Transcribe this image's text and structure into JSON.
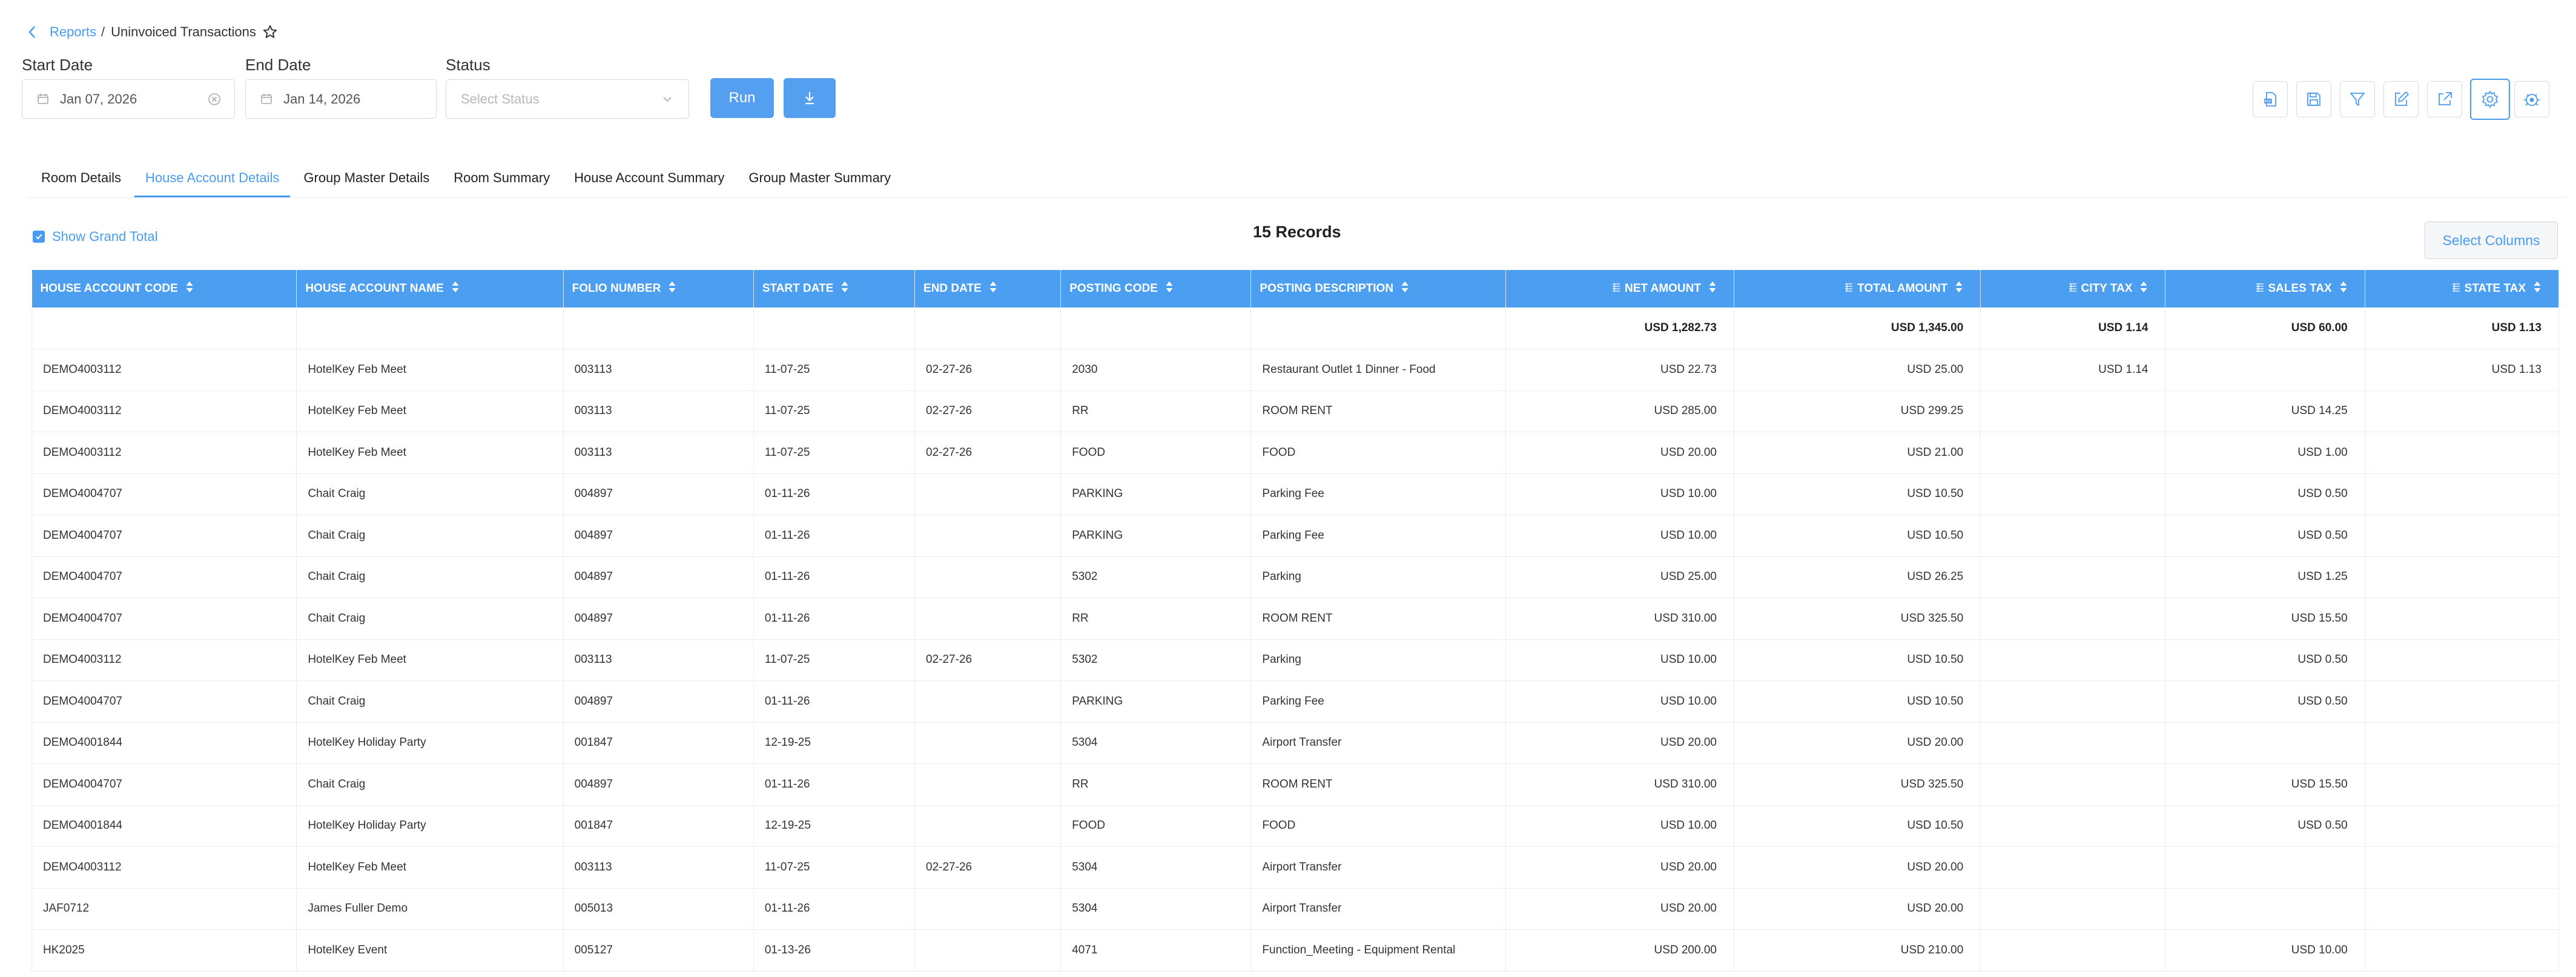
{
  "breadcrumb": {
    "parent": "Reports",
    "separator": "/",
    "current": "Uninvoiced Transactions"
  },
  "filters": {
    "start_date": {
      "label": "Start Date",
      "value": "Jan 07, 2026"
    },
    "end_date": {
      "label": "End Date",
      "value": "Jan 14, 2026"
    },
    "status": {
      "label": "Status",
      "placeholder": "Select Status"
    },
    "run_label": "Run"
  },
  "tabs": [
    {
      "label": "Room Details",
      "active": false
    },
    {
      "label": "House Account Details",
      "active": true
    },
    {
      "label": "Group Master Details",
      "active": false
    },
    {
      "label": "Room Summary",
      "active": false
    },
    {
      "label": "House Account Summary",
      "active": false
    },
    {
      "label": "Group Master Summary",
      "active": false
    }
  ],
  "table_controls": {
    "show_grand_total_label": "Show Grand Total",
    "show_grand_total_checked": true,
    "records": "15 Records",
    "select_columns_label": "Select Columns"
  },
  "columns": [
    "HOUSE ACCOUNT CODE",
    "HOUSE ACCOUNT NAME",
    "FOLIO NUMBER",
    "START DATE",
    "END DATE",
    "POSTING CODE",
    "POSTING DESCRIPTION",
    "NET AMOUNT",
    "TOTAL AMOUNT",
    "CITY TAX",
    "SALES TAX",
    "STATE TAX"
  ],
  "grand_total": [
    "",
    "",
    "",
    "",
    "",
    "",
    "",
    "USD 1,282.73",
    "USD 1,345.00",
    "USD 1.14",
    "USD 60.00",
    "USD 1.13"
  ],
  "rows": [
    [
      "DEMO4003112",
      "HotelKey Feb Meet",
      "003113",
      "11-07-25",
      "02-27-26",
      "2030",
      "Restaurant Outlet 1 Dinner - Food",
      "USD 22.73",
      "USD 25.00",
      "USD 1.14",
      "",
      "USD 1.13"
    ],
    [
      "DEMO4003112",
      "HotelKey Feb Meet",
      "003113",
      "11-07-25",
      "02-27-26",
      "RR",
      "ROOM RENT",
      "USD 285.00",
      "USD 299.25",
      "",
      "USD 14.25",
      ""
    ],
    [
      "DEMO4003112",
      "HotelKey Feb Meet",
      "003113",
      "11-07-25",
      "02-27-26",
      "FOOD",
      "FOOD",
      "USD 20.00",
      "USD 21.00",
      "",
      "USD 1.00",
      ""
    ],
    [
      "DEMO4004707",
      "Chait Craig",
      "004897",
      "01-11-26",
      "",
      "PARKING",
      "Parking Fee",
      "USD 10.00",
      "USD 10.50",
      "",
      "USD 0.50",
      ""
    ],
    [
      "DEMO4004707",
      "Chait Craig",
      "004897",
      "01-11-26",
      "",
      "PARKING",
      "Parking Fee",
      "USD 10.00",
      "USD 10.50",
      "",
      "USD 0.50",
      ""
    ],
    [
      "DEMO4004707",
      "Chait Craig",
      "004897",
      "01-11-26",
      "",
      "5302",
      "Parking",
      "USD 25.00",
      "USD 26.25",
      "",
      "USD 1.25",
      ""
    ],
    [
      "DEMO4004707",
      "Chait Craig",
      "004897",
      "01-11-26",
      "",
      "RR",
      "ROOM RENT",
      "USD 310.00",
      "USD 325.50",
      "",
      "USD 15.50",
      ""
    ],
    [
      "DEMO4003112",
      "HotelKey Feb Meet",
      "003113",
      "11-07-25",
      "02-27-26",
      "5302",
      "Parking",
      "USD 10.00",
      "USD 10.50",
      "",
      "USD 0.50",
      ""
    ],
    [
      "DEMO4004707",
      "Chait Craig",
      "004897",
      "01-11-26",
      "",
      "PARKING",
      "Parking Fee",
      "USD 10.00",
      "USD 10.50",
      "",
      "USD 0.50",
      ""
    ],
    [
      "DEMO4001844",
      "HotelKey Holiday Party",
      "001847",
      "12-19-25",
      "",
      "5304",
      "Airport Transfer",
      "USD 20.00",
      "USD 20.00",
      "",
      "",
      ""
    ],
    [
      "DEMO4004707",
      "Chait Craig",
      "004897",
      "01-11-26",
      "",
      "RR",
      "ROOM RENT",
      "USD 310.00",
      "USD 325.50",
      "",
      "USD 15.50",
      ""
    ],
    [
      "DEMO4001844",
      "HotelKey Holiday Party",
      "001847",
      "12-19-25",
      "",
      "FOOD",
      "FOOD",
      "USD 10.00",
      "USD 10.50",
      "",
      "USD 0.50",
      ""
    ],
    [
      "DEMO4003112",
      "HotelKey Feb Meet",
      "003113",
      "11-07-25",
      "02-27-26",
      "5304",
      "Airport Transfer",
      "USD 20.00",
      "USD 20.00",
      "",
      "",
      ""
    ],
    [
      "JAF0712",
      "James Fuller Demo",
      "005013",
      "01-11-26",
      "",
      "5304",
      "Airport Transfer",
      "USD 20.00",
      "USD 20.00",
      "",
      "",
      ""
    ],
    [
      "HK2025",
      "HotelKey Event",
      "005127",
      "01-13-26",
      "",
      "4071",
      "Function_Meeting - Equipment Rental",
      "USD 200.00",
      "USD 210.00",
      "",
      "USD 10.00",
      ""
    ]
  ],
  "toolbar_icons": [
    "pdf-icon",
    "save-icon",
    "filter-icon",
    "edit-icon",
    "external-link-icon",
    "gear-icon",
    "settings-bug-icon"
  ],
  "accent_color": "#4b9ef0"
}
